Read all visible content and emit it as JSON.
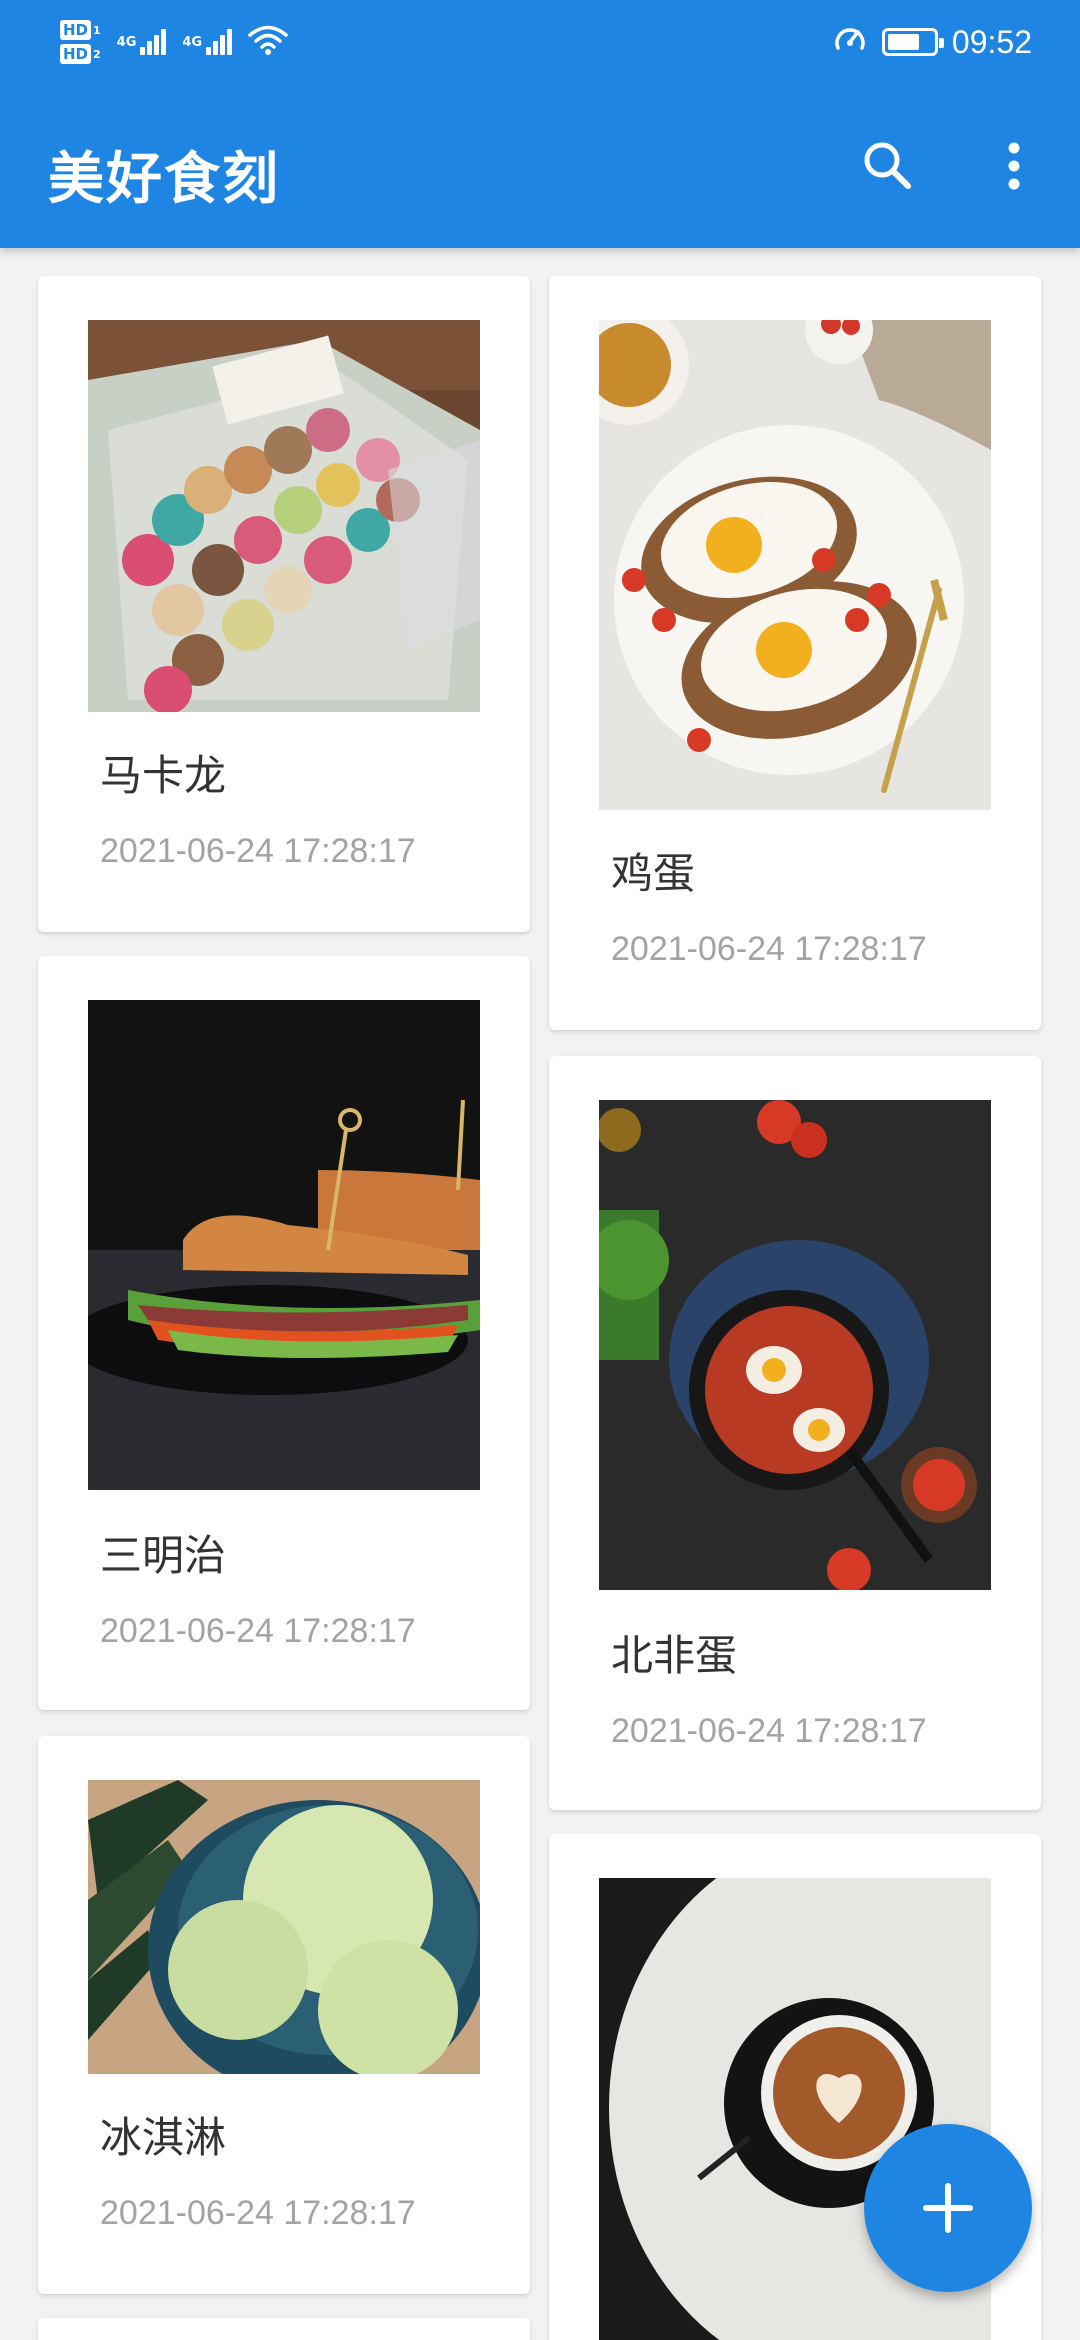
{
  "status_bar": {
    "hd1": "HD",
    "hd1_num": "1",
    "hd2": "HD",
    "hd2_num": "2",
    "net1": "4G",
    "net2": "4G",
    "time": "09:52"
  },
  "app_bar": {
    "title": "美好食刻",
    "search_icon": "search-icon",
    "more_icon": "more-vert-icon"
  },
  "colors": {
    "primary": "#1e86e2",
    "background": "#f2f2f2",
    "title_text": "#333333",
    "time_text": "#a3a3a3"
  },
  "cards": [
    {
      "title": "马卡龙",
      "time": "2021-06-24 17:28:17",
      "image": "macarons-photo"
    },
    {
      "title": "鸡蛋",
      "time": "2021-06-24 17:28:17",
      "image": "eggs-toast-photo"
    },
    {
      "title": "三明治",
      "time": "2021-06-24 17:28:17",
      "image": "sandwich-photo"
    },
    {
      "title": "北非蛋",
      "time": "2021-06-24 17:28:17",
      "image": "shakshuka-photo"
    },
    {
      "title": "冰淇淋",
      "time": "2021-06-24 17:28:17",
      "image": "ice-cream-photo"
    },
    {
      "title": "",
      "time": "",
      "image": "coffee-photo"
    }
  ],
  "fab": {
    "icon": "add-icon"
  }
}
